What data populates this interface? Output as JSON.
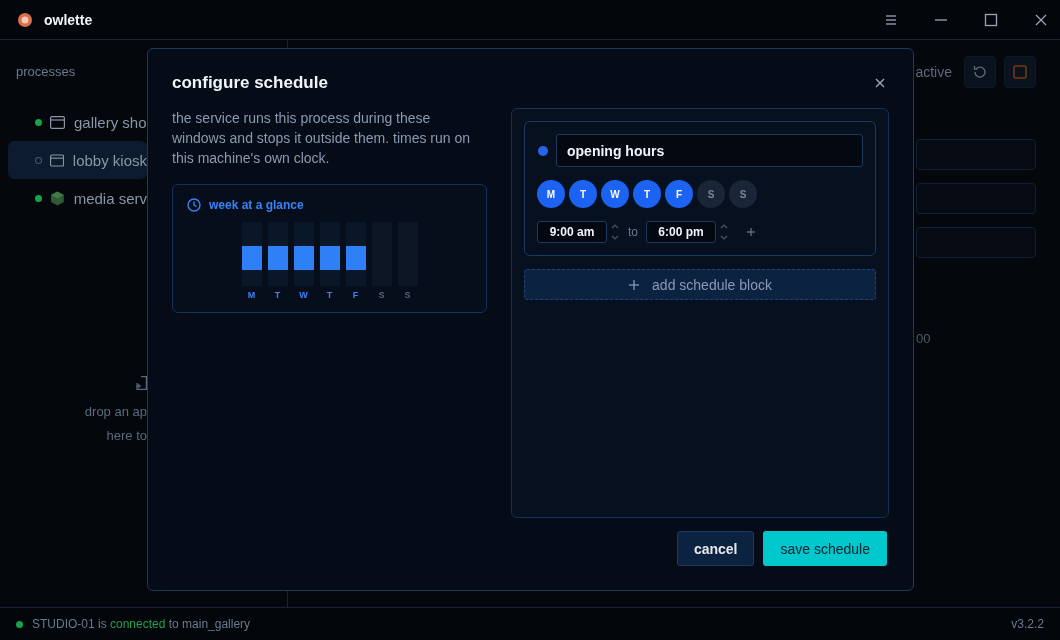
{
  "window": {
    "title": "owlette"
  },
  "sidebar": {
    "heading": "processes",
    "items": [
      {
        "label": "gallery sho",
        "kind": "window",
        "running": true,
        "selected": false
      },
      {
        "label": "lobby kiosk",
        "kind": "window",
        "running": false,
        "selected": true
      },
      {
        "label": "media serv",
        "kind": "package",
        "running": true,
        "selected": false
      }
    ],
    "drop_hint": [
      "drop an ap",
      "here to"
    ]
  },
  "main": {
    "status_text": "active",
    "value_text": "00"
  },
  "dialog": {
    "title": "configure schedule",
    "description": "the service runs this process during these windows and stops it outside them. times run on this machine's own clock.",
    "glance": {
      "title": "week at a glance",
      "days": [
        {
          "label": "M",
          "active": true
        },
        {
          "label": "T",
          "active": true
        },
        {
          "label": "W",
          "active": true
        },
        {
          "label": "T",
          "active": true
        },
        {
          "label": "F",
          "active": true
        },
        {
          "label": "S",
          "active": false
        },
        {
          "label": "S",
          "active": false
        }
      ]
    },
    "blocks": [
      {
        "color": "#2563eb",
        "name": "opening hours",
        "days": [
          {
            "label": "M",
            "selected": true
          },
          {
            "label": "T",
            "selected": true
          },
          {
            "label": "W",
            "selected": true
          },
          {
            "label": "T",
            "selected": true
          },
          {
            "label": "F",
            "selected": true
          },
          {
            "label": "S",
            "selected": false
          },
          {
            "label": "S",
            "selected": false
          }
        ],
        "start": "9:00 am",
        "separator": "to",
        "end": "6:00 pm"
      }
    ],
    "add_block_label": "add schedule block",
    "buttons": [
      {
        "label": "cancel",
        "kind": "secondary"
      },
      {
        "label": "save schedule",
        "kind": "primary"
      }
    ]
  },
  "status_bar": {
    "connected": true,
    "segments": [
      {
        "text": "STUDIO-01 is ",
        "kind": "plain"
      },
      {
        "text": "connected",
        "kind": "status"
      },
      {
        "text": " to main_gallery",
        "kind": "plain"
      }
    ],
    "version": "v3.2.2"
  }
}
